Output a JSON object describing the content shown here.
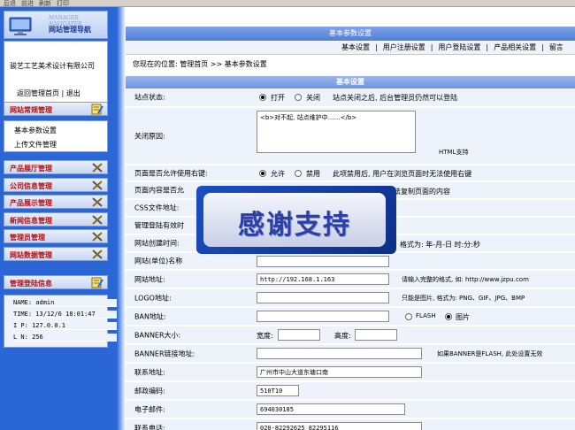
{
  "toolbar": {
    "items": [
      "后退",
      "前进",
      "刷新",
      "打印"
    ]
  },
  "sidebar": {
    "logo_en": "MANAGER NAVIGATER",
    "logo_cn": "网站管理导航",
    "company": "骏艺工艺美术设计有限公司",
    "home_link": "返回管理首页",
    "logout_link": "退出",
    "menus": [
      {
        "label": "网站常规管理",
        "icon": "notepad-icon"
      },
      {
        "label": "产品展厅管理",
        "icon": "tools-icon"
      },
      {
        "label": "公司信息管理",
        "icon": "tools-icon"
      },
      {
        "label": "产品展示管理",
        "icon": "tools-icon"
      },
      {
        "label": "新闻信息管理",
        "icon": "tools-icon"
      },
      {
        "label": "管理员管理",
        "icon": "tools-icon"
      },
      {
        "label": "网站数据管理",
        "icon": "tools-icon"
      },
      {
        "label": "管理登陆信息",
        "icon": "notepad-icon"
      }
    ],
    "submenu": [
      "基本参数设置",
      "上传文件管理"
    ],
    "login": {
      "name": "NAME: admin",
      "time": "TIME: 13/12/6 18:01:47",
      "ip": "I  P: 127.0.0.1",
      "ln": "L  N: 256"
    }
  },
  "main": {
    "title": "基本参数设置",
    "nav": [
      "基本设置",
      "|",
      "用户注册设置",
      "|",
      "用户登陆设置",
      "|",
      "产品相关设置",
      "|",
      "留言"
    ],
    "breadcrumb": "您现在的位置: 管理首页 >> 基本参数设置",
    "section": "基本设置",
    "status": {
      "label": "站点状态:",
      "open": "打开",
      "close": "关闭",
      "note": "站点关闭之后, 后台管理员仍然可以登陆"
    },
    "close_reason": {
      "label": "关闭原因:",
      "value": "<b>对不起, 站点维护中……</b>",
      "note": "HTML支持"
    },
    "right_click": {
      "label": "页面是否允许使用右键:",
      "allow": "允许",
      "deny": "禁用",
      "note": "此项禁用后, 用户在浏览页面时无法使用右键"
    },
    "copy_content": {
      "label": "页面内容是否允",
      "note": "法复制页面的内容"
    },
    "css": {
      "label": "CSS文件地址:"
    },
    "login_valid": {
      "label": "管理登陆有效时"
    },
    "created": {
      "label": "网站创建时间:",
      "note": "格式为: 年-月-日 时:分:秒"
    },
    "unit": {
      "label": "网站(单位)名称"
    },
    "site_url": {
      "label": "网站地址:",
      "value": "http://192.168.1.163",
      "note": "请输入完整的格式, 如: http://www.jzpu.com"
    },
    "logo": {
      "label": "LOGO地址:",
      "note": "只能是图片, 格式为: PNG、GIF、JPG、BMP"
    },
    "ban": {
      "label": "BAN地址:",
      "flash": "FLASH",
      "image": "图片"
    },
    "banner_size": {
      "label": "BANNER大小:",
      "width": "宽度:",
      "height": "高度:"
    },
    "banner_link": {
      "label": "BANNER链接地址:",
      "note": "如果BANNER是FLASH, 此处设置无效"
    },
    "address": {
      "label": "联系地址:",
      "value": "广州市中山大道东塘口南"
    },
    "postcode": {
      "label": "邮政编码:",
      "value": "510T10"
    },
    "email": {
      "label": "电子邮件:",
      "value": "694030185"
    },
    "phone": {
      "label": "联系电话:",
      "value": "020-82292625 82295116"
    }
  },
  "overlay": {
    "text": "感谢支持"
  }
}
